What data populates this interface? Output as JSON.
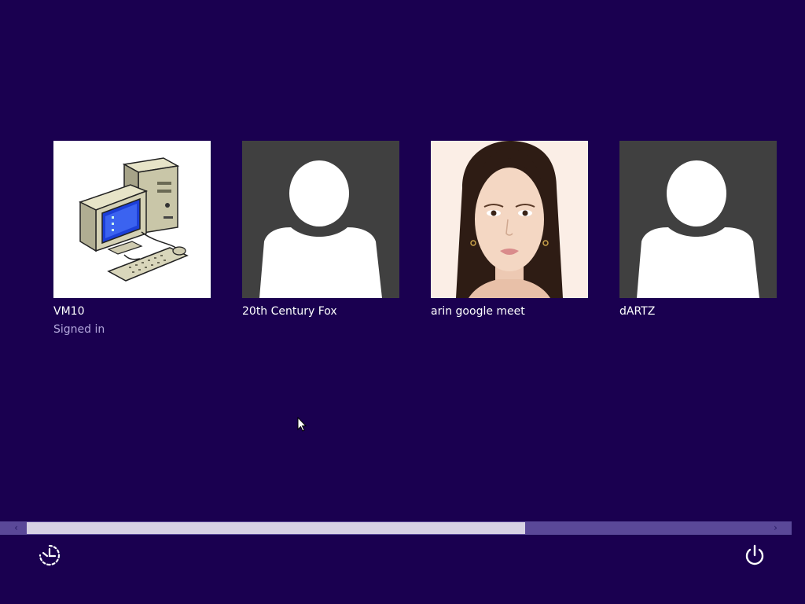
{
  "colors": {
    "background": "#1a0050",
    "default_avatar_bg": "#404040",
    "signed_in_text": "#b3a6dc",
    "scrollbar_track": "#5a4898",
    "scrollbar_thumb": "#d7d2e4"
  },
  "users": [
    {
      "name": "VM10",
      "status": "Signed in",
      "avatar": "computer-icon"
    },
    {
      "name": "20th Century Fox",
      "status": "",
      "avatar": "default-user-icon"
    },
    {
      "name": "arin google meet",
      "status": "",
      "avatar": "user-photo"
    },
    {
      "name": "dARTZ",
      "status": "",
      "avatar": "default-user-icon"
    }
  ],
  "scrollbar": {
    "left_arrow": "‹",
    "right_arrow": "›",
    "thumb_fraction": 0.65
  },
  "bottom": {
    "left_icon": "ease-of-access-icon",
    "right_icon": "power-icon"
  }
}
